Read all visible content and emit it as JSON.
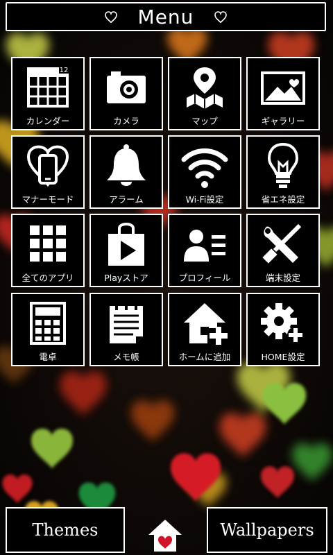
{
  "header": {
    "title": "Menu"
  },
  "tiles": [
    {
      "label": "カレンダー",
      "icon": "calendar-icon",
      "badge": "12"
    },
    {
      "label": "カメラ",
      "icon": "camera-icon"
    },
    {
      "label": "マップ",
      "icon": "map-icon"
    },
    {
      "label": "ギャラリー",
      "icon": "gallery-icon"
    },
    {
      "label": "マナーモード",
      "icon": "manner-mode-icon"
    },
    {
      "label": "アラーム",
      "icon": "alarm-bell-icon"
    },
    {
      "label": "Wi-Fi設定",
      "icon": "wifi-icon"
    },
    {
      "label": "省エネ設定",
      "icon": "lightbulb-icon"
    },
    {
      "label": "全てのアプリ",
      "icon": "apps-grid-icon"
    },
    {
      "label": "Playストア",
      "icon": "play-store-icon"
    },
    {
      "label": "プロフィール",
      "icon": "profile-icon"
    },
    {
      "label": "端末設定",
      "icon": "tools-icon"
    },
    {
      "label": "電卓",
      "icon": "calculator-icon"
    },
    {
      "label": "メモ帳",
      "icon": "notepad-icon"
    },
    {
      "label": "ホームに追加",
      "icon": "add-home-icon"
    },
    {
      "label": "HOME設定",
      "icon": "home-settings-icon"
    }
  ],
  "footer": {
    "themes_label": "Themes",
    "wallpapers_label": "Wallpapers"
  },
  "colors": {
    "background": "#000000",
    "foreground": "#ffffff",
    "heart_accent": "#d0122a"
  }
}
